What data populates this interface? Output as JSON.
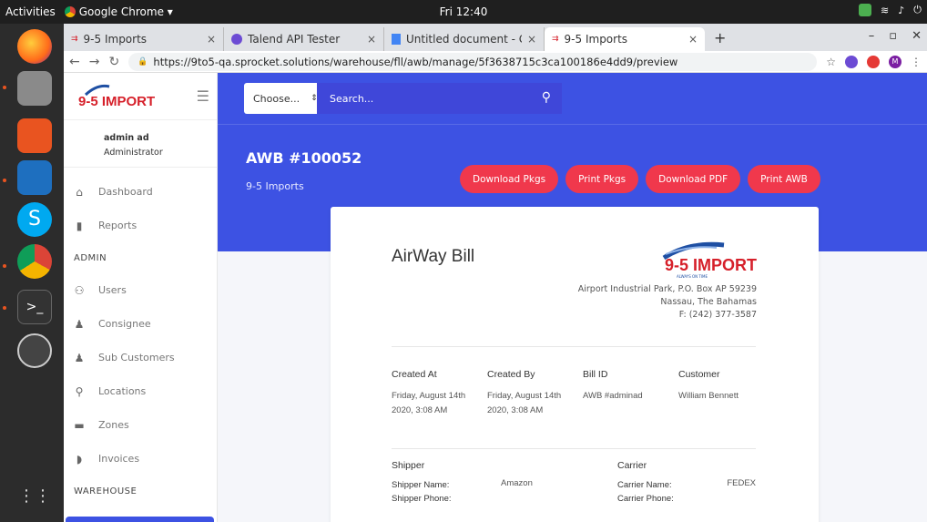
{
  "system": {
    "activities": "Activities",
    "app": "Google Chrome ▾",
    "clock": "Fri 12:40"
  },
  "browser": {
    "tabs": [
      {
        "title": "9-5 Imports",
        "close": "×"
      },
      {
        "title": "Talend API Tester",
        "close": "×"
      },
      {
        "title": "Untitled document - Goog",
        "close": "×"
      },
      {
        "title": "9-5 Imports",
        "close": "×"
      }
    ],
    "new_tab": "+",
    "url": "https://9to5-qa.sprocket.solutions/warehouse/fll/awb/manage/5f3638715c3ca100186e4dd9/preview",
    "profile_initial": "M"
  },
  "sidebar": {
    "logo": "9-5 IMPORT",
    "user_name": "admin ad",
    "user_role": "Administrator",
    "items": [
      {
        "label": "Dashboard",
        "icon": "home-icon"
      },
      {
        "label": "Reports",
        "icon": "file-icon"
      }
    ],
    "section_admin": "ADMIN",
    "admin_items": [
      {
        "label": "Users",
        "icon": "users-icon"
      },
      {
        "label": "Consignee",
        "icon": "user-icon"
      },
      {
        "label": "Sub Customers",
        "icon": "user-icon"
      },
      {
        "label": "Locations",
        "icon": "map-pin-icon"
      },
      {
        "label": "Zones",
        "icon": "inbox-icon"
      },
      {
        "label": "Invoices",
        "icon": "shield-icon"
      }
    ],
    "section_warehouse": "WAREHOUSE"
  },
  "header": {
    "select_value": "Choose...",
    "search_placeholder": "Search...",
    "title": "AWB #100052",
    "subtitle": "9-5 Imports",
    "buttons": [
      "Download Pkgs",
      "Print Pkgs",
      "Download PDF",
      "Print AWB"
    ]
  },
  "bill": {
    "title": "AirWay Bill",
    "logo": "9-5 IMPORT",
    "logo_tag": "ALWAYS ON TIME",
    "address": [
      "Airport Industrial Park, P.O. Box AP 59239",
      "Nassau, The Bahamas",
      "F: (242) 377-3587"
    ],
    "info": [
      {
        "label": "Created At",
        "value1": "Friday, August 14th",
        "value2": "2020, 3:08 AM"
      },
      {
        "label": "Created By",
        "value1": "Friday, August 14th",
        "value2": "2020, 3:08 AM"
      },
      {
        "label": "Bill ID",
        "value1": "AWB #adminad",
        "value2": ""
      },
      {
        "label": "Customer",
        "value1": "William Bennett",
        "value2": ""
      }
    ],
    "shipper": {
      "heading": "Shipper",
      "name_label": "Shipper Name:",
      "name": "Amazon",
      "phone_label": "Shipper Phone:"
    },
    "carrier": {
      "heading": "Carrier",
      "name_label": "Carrier Name:",
      "name": "FEDEX",
      "phone_label": "Carrier Phone:"
    }
  }
}
